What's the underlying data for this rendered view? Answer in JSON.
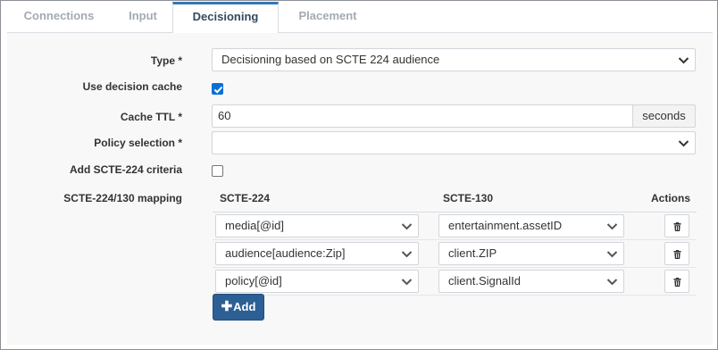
{
  "tabs": [
    {
      "label": "Connections",
      "active": false
    },
    {
      "label": "Input",
      "active": false
    },
    {
      "label": "Decisioning",
      "active": true
    },
    {
      "label": "Placement",
      "active": false
    }
  ],
  "form": {
    "type": {
      "label": "Type *",
      "value": "Decisioning based on SCTE 224 audience"
    },
    "use_decision_cache": {
      "label": "Use decision cache",
      "checked": true
    },
    "cache_ttl": {
      "label": "Cache TTL *",
      "value": "60",
      "unit": "seconds"
    },
    "policy_selection": {
      "label": "Policy selection *",
      "value": ""
    },
    "add_scte224_criteria": {
      "label": "Add SCTE-224 criteria",
      "checked": false
    },
    "mapping": {
      "label": "SCTE-224/130 mapping",
      "columns": {
        "scte224": "SCTE-224",
        "scte130": "SCTE-130",
        "actions": "Actions"
      },
      "rows": [
        {
          "scte224": "media[@id]",
          "scte130": "entertainment.assetID"
        },
        {
          "scte224": "audience[audience:Zip]",
          "scte130": "client.ZIP"
        },
        {
          "scte224": "policy[@id]",
          "scte130": "client.SignalId"
        }
      ],
      "add_label": "Add"
    }
  },
  "colors": {
    "accent": "#3577b3",
    "button": "#2c5f93",
    "checkbox": "#0b6fd6"
  },
  "icons": {
    "chevron": "chevron-down-icon",
    "trash": "trash-icon",
    "plus": "plus-icon"
  }
}
